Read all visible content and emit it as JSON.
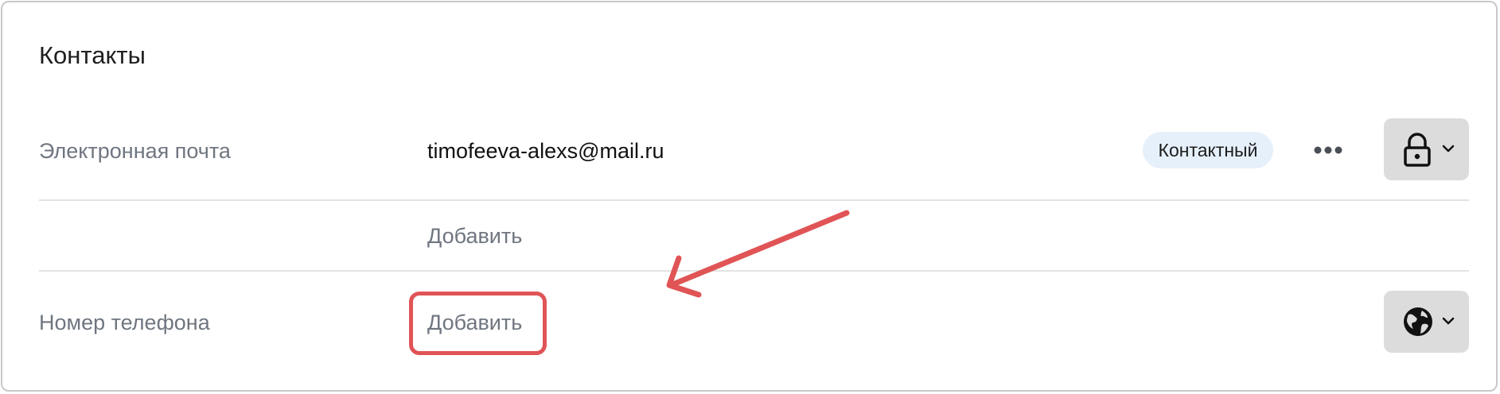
{
  "section": {
    "title": "Контакты"
  },
  "email_row": {
    "label": "Электронная почта",
    "value": "timofeeva-alexs@mail.ru",
    "badge": "Контактный",
    "more_icon": "more-dots-icon",
    "privacy_icon": "lock-icon"
  },
  "email_add": {
    "label": "Добавить"
  },
  "phone_row": {
    "label": "Номер телефона",
    "add_label": "Добавить",
    "privacy_icon": "globe-icon"
  },
  "annotation": {
    "highlight_color": "#e05456",
    "arrow_color": "#e05456"
  },
  "colors": {
    "badge_background": "#e6f0fb",
    "button_background": "#dcdcdc",
    "label_color": "#6f7680"
  }
}
